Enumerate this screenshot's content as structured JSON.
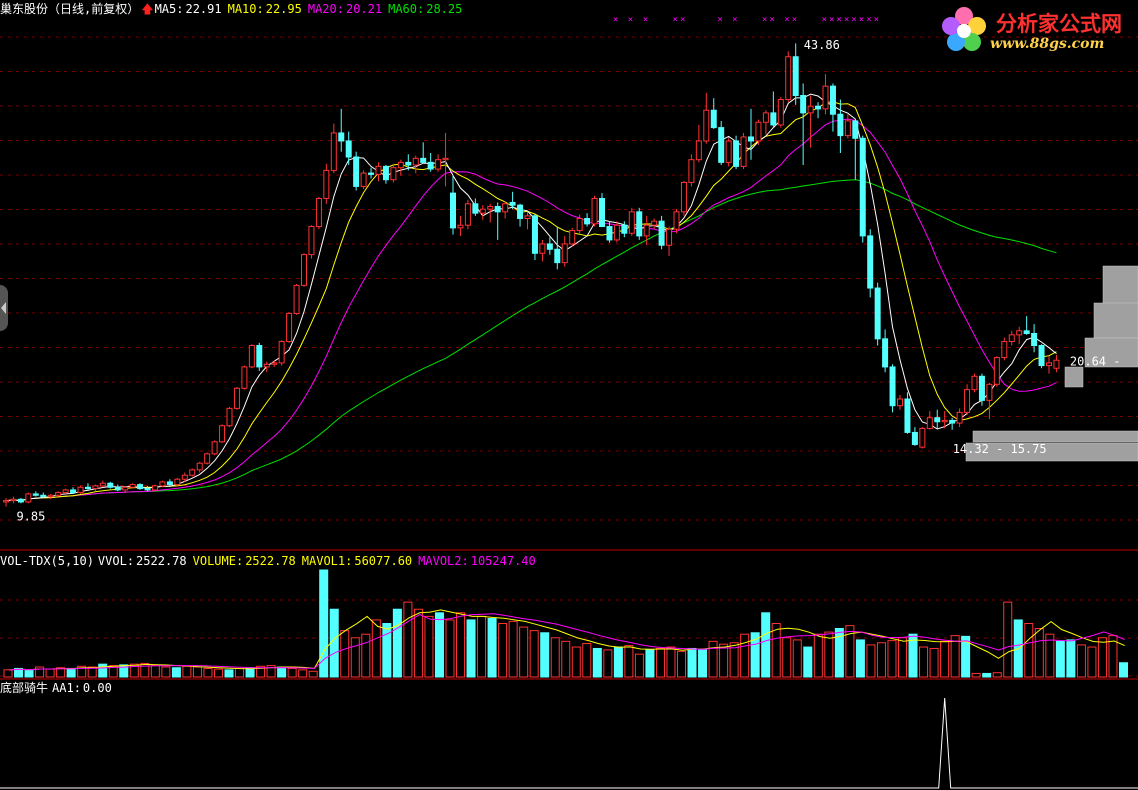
{
  "header": {
    "stock": "巢东股份（日线,前复权）",
    "ma5_label": "MA5:",
    "ma5_value": "22.91",
    "ma10_label": "MA10:",
    "ma10_value": "22.95",
    "ma20_label": "MA20:",
    "ma20_value": "20.21",
    "ma60_label": "MA60:",
    "ma60_value": "28.25"
  },
  "volume_header": {
    "name": "VOL-TDX(5,10)",
    "vvol_label": "VVOL:",
    "vvol_value": "2522.78",
    "volume_label": "VOLUME:",
    "volume_value": "2522.78",
    "mavol1_label": "MAVOL1:",
    "mavol1_value": "56077.60",
    "mavol2_label": "MAVOL2:",
    "mavol2_value": "105247.40"
  },
  "indicator_header": {
    "name": "底部骑牛",
    "aa1_label": "AA1:",
    "aa1_value": "0.00"
  },
  "logo": {
    "text": "分析家公式网",
    "url": "www.88gs.com"
  },
  "colors": {
    "up": "#ff3232",
    "down": "#54ffff",
    "ma5": "#ffffff",
    "ma10": "#ffff00",
    "ma20": "#ff00ff",
    "ma60": "#00e000",
    "grid": "#7a0000",
    "divider": "#c00000",
    "profile": "#a0a0a0"
  },
  "chart_data": [
    {
      "type": "candlestick",
      "title": "巢东股份（日线,前复权）",
      "ylim": [
        9,
        45.5
      ],
      "price_labels": [
        {
          "text": "9.85",
          "index": 1,
          "value": 9.85
        },
        {
          "text": "43.86",
          "index": 106,
          "value": 43.86
        },
        {
          "text": "14.32 - 15.75",
          "index": 126,
          "value": 14.32
        },
        {
          "text": "20.64 -",
          "index": 142,
          "value": 20.64
        }
      ],
      "signal_markers": {
        "text": "× ×",
        "indices": [
          82,
          84,
          86,
          90,
          91,
          96,
          98,
          102,
          103,
          105,
          106,
          110,
          111,
          112,
          113,
          114,
          115,
          116,
          117
        ]
      },
      "candles": [
        [
          10.2,
          10.5,
          9.85,
          10.3
        ],
        [
          10.3,
          10.6,
          10.1,
          10.4
        ],
        [
          10.4,
          10.5,
          10.1,
          10.2
        ],
        [
          10.2,
          10.9,
          10.1,
          10.8
        ],
        [
          10.8,
          11.0,
          10.6,
          10.7
        ],
        [
          10.7,
          10.9,
          10.5,
          10.6
        ],
        [
          10.6,
          10.8,
          10.4,
          10.7
        ],
        [
          10.7,
          11.0,
          10.6,
          10.9
        ],
        [
          10.9,
          11.2,
          10.7,
          11.1
        ],
        [
          11.1,
          11.3,
          10.8,
          10.9
        ],
        [
          10.9,
          11.4,
          10.8,
          11.3
        ],
        [
          11.3,
          11.6,
          11.1,
          11.2
        ],
        [
          11.2,
          11.5,
          11.0,
          11.4
        ],
        [
          11.4,
          11.8,
          11.3,
          11.6
        ],
        [
          11.6,
          11.7,
          11.2,
          11.3
        ],
        [
          11.3,
          11.5,
          11.0,
          11.1
        ],
        [
          11.1,
          11.4,
          10.9,
          11.3
        ],
        [
          11.3,
          11.6,
          11.2,
          11.5
        ],
        [
          11.5,
          11.6,
          11.1,
          11.2
        ],
        [
          11.2,
          11.4,
          11.0,
          11.1
        ],
        [
          11.1,
          11.5,
          11.0,
          11.4
        ],
        [
          11.4,
          11.8,
          11.3,
          11.7
        ],
        [
          11.7,
          11.9,
          11.4,
          11.5
        ],
        [
          11.5,
          12.0,
          11.4,
          11.9
        ],
        [
          11.9,
          12.4,
          11.7,
          12.2
        ],
        [
          12.2,
          12.7,
          12.1,
          12.6
        ],
        [
          12.6,
          13.2,
          12.4,
          13.1
        ],
        [
          13.1,
          13.9,
          13.0,
          13.8
        ],
        [
          13.8,
          14.8,
          13.7,
          14.7
        ],
        [
          14.7,
          16.0,
          14.6,
          15.9
        ],
        [
          15.9,
          17.3,
          15.8,
          17.2
        ],
        [
          17.2,
          18.8,
          17.1,
          18.7
        ],
        [
          18.7,
          20.4,
          18.6,
          20.3
        ],
        [
          20.3,
          22.0,
          20.2,
          21.9
        ],
        [
          21.9,
          22.1,
          20.0,
          20.3
        ],
        [
          20.3,
          20.7,
          19.9,
          20.5
        ],
        [
          20.5,
          20.8,
          20.3,
          20.6
        ],
        [
          20.6,
          22.3,
          20.4,
          22.2
        ],
        [
          22.2,
          24.4,
          22.1,
          24.3
        ],
        [
          24.3,
          26.5,
          24.2,
          26.4
        ],
        [
          26.4,
          28.8,
          26.3,
          28.7
        ],
        [
          28.7,
          30.9,
          28.4,
          30.8
        ],
        [
          30.8,
          33.0,
          30.6,
          32.9
        ],
        [
          32.9,
          35.5,
          32.5,
          35.0
        ],
        [
          35.0,
          38.5,
          34.8,
          37.8
        ],
        [
          37.8,
          39.6,
          36.4,
          37.2
        ],
        [
          37.2,
          37.9,
          35.4,
          36.0
        ],
        [
          36.0,
          36.4,
          33.5,
          33.8
        ],
        [
          33.8,
          35.0,
          33.6,
          34.8
        ],
        [
          34.8,
          35.2,
          34.4,
          34.7
        ],
        [
          34.7,
          35.6,
          34.2,
          35.3
        ],
        [
          35.3,
          35.4,
          34.0,
          34.3
        ],
        [
          34.3,
          35.5,
          34.1,
          35.2
        ],
        [
          35.2,
          35.8,
          34.6,
          35.6
        ],
        [
          35.6,
          36.2,
          35.0,
          35.4
        ],
        [
          35.4,
          36.1,
          34.8,
          35.9
        ],
        [
          35.9,
          37.1,
          35.5,
          35.6
        ],
        [
          35.6,
          36.3,
          34.9,
          35.1
        ],
        [
          35.1,
          36.2,
          34.9,
          35.8
        ],
        [
          35.8,
          37.8,
          33.8,
          35.9
        ],
        [
          33.3,
          34.6,
          30.2,
          30.7
        ],
        [
          30.7,
          31.6,
          30.1,
          30.9
        ],
        [
          30.9,
          32.8,
          30.6,
          32.5
        ],
        [
          32.5,
          32.9,
          31.6,
          31.8
        ],
        [
          31.8,
          32.4,
          31.3,
          32.1
        ],
        [
          32.1,
          32.5,
          31.1,
          32.3
        ],
        [
          32.3,
          32.6,
          29.8,
          31.9
        ],
        [
          31.9,
          32.7,
          31.4,
          32.5
        ],
        [
          32.6,
          33.4,
          32.1,
          32.4
        ],
        [
          32.4,
          32.5,
          30.8,
          31.4
        ],
        [
          31.4,
          31.9,
          30.6,
          31.6
        ],
        [
          31.6,
          31.7,
          28.3,
          28.8
        ],
        [
          28.8,
          29.8,
          28.2,
          29.5
        ],
        [
          29.5,
          30.0,
          28.7,
          29.1
        ],
        [
          29.1,
          30.8,
          27.6,
          28.1
        ],
        [
          28.1,
          30.1,
          27.8,
          29.5
        ],
        [
          29.5,
          30.7,
          29.3,
          30.5
        ],
        [
          30.5,
          31.7,
          30.3,
          31.4
        ],
        [
          31.4,
          31.8,
          30.8,
          31.0
        ],
        [
          31.0,
          33.1,
          30.8,
          32.9
        ],
        [
          32.9,
          33.3,
          31.9,
          30.8
        ],
        [
          30.8,
          31.2,
          29.6,
          29.8
        ],
        [
          29.8,
          31.2,
          29.6,
          30.9
        ],
        [
          30.9,
          31.2,
          30.0,
          30.3
        ],
        [
          30.3,
          32.2,
          30.1,
          31.9
        ],
        [
          31.9,
          32.2,
          29.8,
          30.1
        ],
        [
          30.1,
          31.6,
          29.4,
          30.9
        ],
        [
          30.9,
          31.4,
          30.6,
          31.2
        ],
        [
          31.2,
          31.6,
          29.1,
          29.4
        ],
        [
          29.4,
          30.8,
          28.6,
          30.6
        ],
        [
          30.6,
          32.1,
          30.3,
          31.9
        ],
        [
          31.9,
          34.2,
          31.6,
          34.1
        ],
        [
          34.1,
          36.2,
          33.8,
          35.8
        ],
        [
          35.8,
          38.4,
          35.6,
          37.2
        ],
        [
          37.2,
          40.8,
          37.0,
          39.5
        ],
        [
          39.5,
          40.4,
          38.1,
          38.2
        ],
        [
          38.2,
          38.7,
          35.4,
          35.6
        ],
        [
          35.6,
          37.4,
          35.3,
          37.2
        ],
        [
          37.2,
          37.6,
          35.1,
          35.3
        ],
        [
          35.3,
          37.8,
          35.1,
          37.5
        ],
        [
          37.5,
          39.6,
          35.8,
          37.2
        ],
        [
          37.2,
          38.8,
          36.9,
          38.6
        ],
        [
          38.6,
          39.5,
          37.7,
          39.3
        ],
        [
          39.3,
          40.9,
          38.2,
          38.4
        ],
        [
          38.4,
          40.5,
          38.2,
          40.3
        ],
        [
          40.3,
          43.9,
          40.1,
          43.5
        ],
        [
          43.5,
          44.5,
          39.9,
          40.6
        ],
        [
          40.6,
          41.5,
          35.4,
          39.3
        ],
        [
          39.3,
          40.6,
          36.7,
          39.8
        ],
        [
          39.8,
          40.1,
          38.9,
          39.6
        ],
        [
          39.6,
          42.2,
          39.2,
          41.3
        ],
        [
          41.3,
          41.5,
          37.9,
          39.2
        ],
        [
          39.2,
          40.3,
          36.3,
          37.6
        ],
        [
          37.6,
          39.2,
          37.4,
          38.7
        ],
        [
          38.7,
          38.8,
          34.3,
          37.4
        ],
        [
          37.4,
          37.6,
          29.6,
          30.1
        ],
        [
          30.1,
          30.6,
          25.5,
          26.2
        ],
        [
          26.2,
          26.6,
          21.9,
          22.4
        ],
        [
          22.4,
          23.1,
          19.9,
          20.3
        ],
        [
          20.3,
          20.5,
          16.9,
          17.4
        ],
        [
          17.4,
          18.2,
          17.1,
          17.9
        ],
        [
          17.9,
          18.4,
          15.3,
          15.4
        ],
        [
          15.4,
          15.8,
          14.4,
          14.5
        ],
        [
          14.3,
          15.8,
          14.2,
          15.7
        ],
        [
          15.7,
          17.0,
          15.6,
          16.5
        ],
        [
          16.5,
          17.1,
          15.7,
          16.2
        ],
        [
          16.2,
          17.0,
          15.7,
          16.3
        ],
        [
          16.3,
          16.5,
          15.6,
          16.1
        ],
        [
          16.1,
          17.2,
          15.8,
          16.9
        ],
        [
          16.9,
          19.0,
          16.7,
          18.6
        ],
        [
          18.6,
          19.8,
          18.4,
          19.6
        ],
        [
          19.6,
          19.8,
          17.4,
          17.8
        ],
        [
          17.8,
          19.1,
          16.4,
          19.0
        ],
        [
          19.0,
          21.1,
          18.8,
          21.0
        ],
        [
          21.0,
          22.5,
          20.8,
          22.2
        ],
        [
          22.2,
          23.0,
          21.9,
          22.7
        ],
        [
          22.7,
          23.3,
          22.0,
          23.0
        ],
        [
          23.0,
          24.1,
          22.7,
          22.8
        ],
        [
          22.8,
          23.5,
          21.4,
          21.9
        ],
        [
          21.9,
          22.0,
          20.2,
          20.4
        ],
        [
          20.4,
          21.1,
          19.8,
          20.6
        ],
        [
          20.2,
          21.2,
          19.9,
          20.8
        ]
      ],
      "ma5": [
        10.3,
        10.2,
        10.3,
        10.5,
        10.7,
        10.8,
        11.0,
        11.2,
        11.4,
        11.7,
        12.1,
        12.6,
        13.2,
        14.0,
        14.9,
        15.8,
        17.0,
        18.2,
        19.2,
        20.1,
        21.0,
        22.5,
        24.2,
        26.2,
        28.4,
        30.4,
        32.0,
        33.4,
        34.6,
        35.4,
        35.5,
        35.3,
        35.3,
        35.3,
        35.2,
        35.2,
        35.3,
        35.4,
        35.5,
        35.5,
        35.3,
        34.5,
        33.2,
        32.4,
        32.1,
        31.6,
        31.2,
        30.8,
        30.5,
        30.1,
        30.0,
        30.0,
        30.1,
        30.2,
        30.6,
        31.3,
        32.3,
        33.5,
        34.4,
        35.3,
        35.8,
        36.7,
        37.7,
        38.3,
        38.7,
        39.2,
        39.5,
        39.4,
        38.8,
        37.4,
        35.1,
        31.5,
        27.5,
        24.0,
        21.0,
        18.5,
        17.0,
        16.2,
        15.8,
        16.1,
        16.5,
        16.9,
        17.6,
        18.4,
        19.5,
        20.7,
        21.3,
        21.5,
        21.2,
        21.4,
        22.4,
        22.9
      ]
    },
    {
      "type": "bar",
      "title": "VOL-TDX(5,10)",
      "ylim": [
        0,
        150000
      ],
      "values": [
        10000,
        12000,
        9000,
        14000,
        11000,
        13000,
        12000,
        15000,
        14000,
        18000,
        16000,
        17000,
        18000,
        19000,
        16000,
        14000,
        13000,
        15000,
        14000,
        12000,
        11000,
        10000,
        12000,
        13000,
        15000,
        16000,
        14000,
        12000,
        10000,
        8000,
        150000,
        95000,
        65000,
        55000,
        60000,
        80000,
        75000,
        95000,
        105000,
        95000,
        85000,
        90000,
        80000,
        90000,
        80000,
        85000,
        82000,
        75000,
        78000,
        70000,
        65000,
        62000,
        55000,
        50000,
        42000,
        47000,
        40000,
        38000,
        42000,
        44000,
        32000,
        38000,
        40000,
        42000,
        36000,
        40000,
        38000,
        50000,
        46000,
        48000,
        60000,
        62000,
        90000,
        75000,
        55000,
        52000,
        42000,
        60000,
        63000,
        68000,
        72000,
        52000,
        45000,
        48000,
        51000,
        55000,
        60000,
        42000,
        40000,
        50000,
        58000,
        57000,
        5000,
        5000,
        6000,
        105000,
        80000,
        75000,
        68000,
        60000,
        50000,
        52000,
        45000,
        42000,
        55000,
        58000,
        20000
      ],
      "max_label": "MAVOL2: 105247.40"
    },
    {
      "type": "line",
      "title": "底部骑牛",
      "series": [
        {
          "name": "AA1",
          "spike_index": 126,
          "value": 1
        }
      ]
    }
  ]
}
